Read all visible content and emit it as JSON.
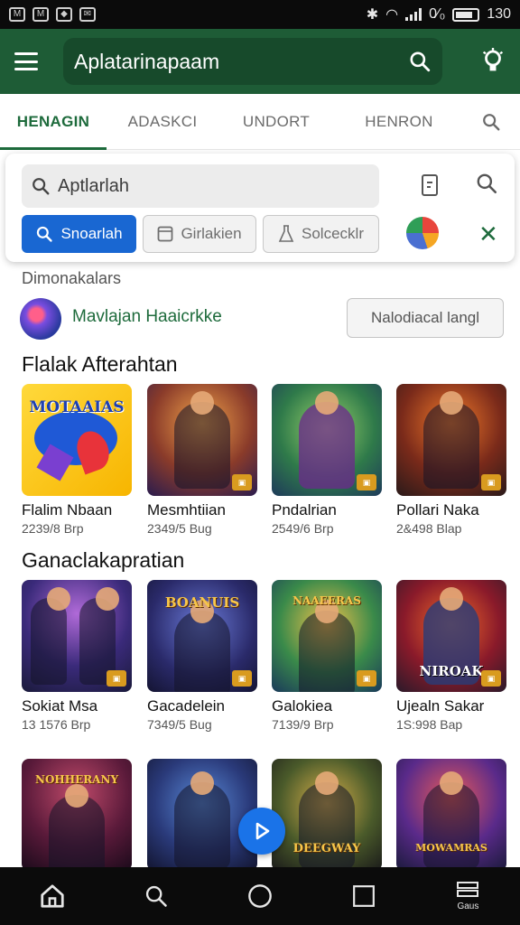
{
  "status_bar": {
    "right_text": "0⁄₀",
    "time": "130"
  },
  "app_bar": {
    "title": "Aplatarinapaam"
  },
  "tabs": [
    {
      "label": "HENAGIN",
      "active": true
    },
    {
      "label": "ADASKCI",
      "active": false
    },
    {
      "label": "UNDORT",
      "active": false
    },
    {
      "label": "HENRON",
      "active": false
    }
  ],
  "search_card": {
    "query": "Aptlarlah",
    "chips": [
      {
        "label": "Snoarlah",
        "icon": "search-icon"
      },
      {
        "label": "Girlakien",
        "icon": "square-icon"
      },
      {
        "label": "Solcecklr",
        "icon": "flask-icon"
      }
    ]
  },
  "developer": {
    "label": "Dimonakalars",
    "name": "Mavlajan Haaicrkke",
    "button": "Nalodiacal langl"
  },
  "sections": [
    {
      "title": "Flalak Afterahtan",
      "items": [
        {
          "name": "Flalim Nbaan",
          "size": "2239/8 Brp",
          "art": "logo",
          "logo_text": "MOTAAIAS"
        },
        {
          "name": "Mesmhtiian",
          "size": "2349/5 Bug",
          "art": "hero"
        },
        {
          "name": "Pndalrian",
          "size": "2549/6 Brp",
          "art": "hero"
        },
        {
          "name": "Pollari Naka",
          "size": "2&498 Blap",
          "art": "hero"
        }
      ]
    },
    {
      "title": "Ganaclakapratian",
      "items": [
        {
          "name": "Sokiat Msa",
          "size": "13 1576 Brp",
          "art": "hero"
        },
        {
          "name": "Gacadelein",
          "size": "7349/5 Bug",
          "art": "hero",
          "logo_text": "BOANUIS"
        },
        {
          "name": "Galokiea",
          "size": "7139/9 Brp",
          "art": "hero",
          "logo_text": "NAAEERAS"
        },
        {
          "name": "Ujealn Sakar",
          "size": "1S:998 Bap",
          "art": "hero",
          "logo_text": "NIROAK"
        }
      ]
    },
    {
      "title": "",
      "items": [
        {
          "name": "",
          "size": "",
          "art": "hero",
          "logo_text": "NOHHERANY"
        },
        {
          "name": "",
          "size": "",
          "art": "hero"
        },
        {
          "name": "",
          "size": "",
          "art": "hero",
          "logo_text": "DEEGWAY"
        },
        {
          "name": "",
          "size": "",
          "art": "hero",
          "logo_text": "MOWAMRAS"
        }
      ]
    }
  ],
  "bottom_nav": {
    "last_label": "Gaus"
  },
  "colors": {
    "app_bar": "#1e5c36",
    "accent": "#1e6b3c",
    "primary_chip": "#1967d2",
    "fab": "#1a73e8"
  }
}
